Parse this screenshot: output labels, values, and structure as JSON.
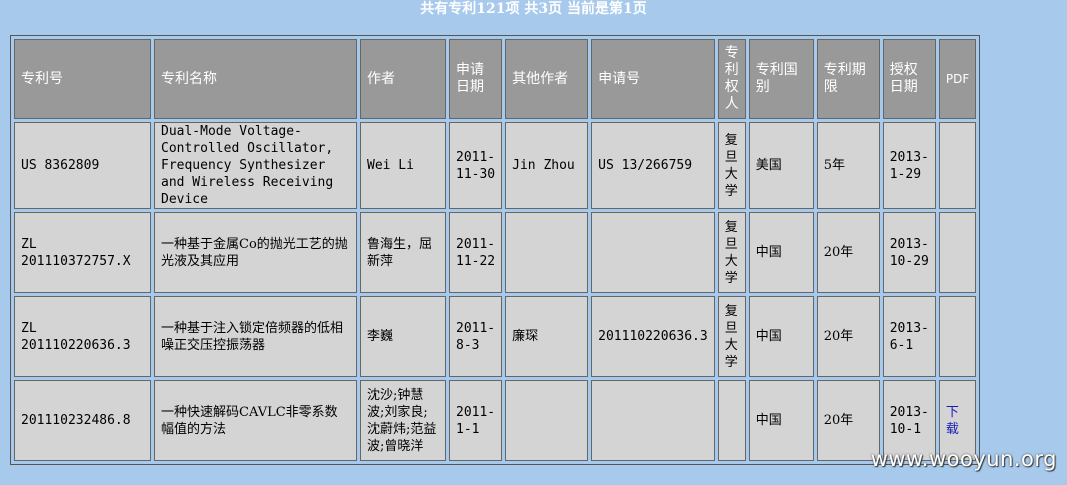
{
  "summary": "共有专利121项  共3页  当前是第1页",
  "headers": {
    "patent_no": "专利号",
    "patent_name": "专利名称",
    "author": "作者",
    "apply_date": "申请日期",
    "other_authors": "其他作者",
    "apply_no": "申请号",
    "holder": "专利权人",
    "country": "专利国别",
    "term": "专利期限",
    "grant_date": "授权日期",
    "pdf": "PDF"
  },
  "rows": [
    {
      "patent_no": "US 8362809",
      "patent_name": "Dual-Mode Voltage-Controlled Oscillator, Frequency Synthesizer and Wireless Receiving Device",
      "author": "Wei Li",
      "apply_date": "2011-11-30",
      "other_authors": "Jin Zhou",
      "apply_no": "US 13/266759",
      "holder": "复旦大学",
      "country": "美国",
      "term": "5年",
      "grant_date": "2013-1-29",
      "pdf": ""
    },
    {
      "patent_no": "ZL 201110372757.X",
      "patent_name": "一种基于金属Co的抛光工艺的抛光液及其应用",
      "author": "鲁海生，屈新萍",
      "apply_date": "2011-11-22",
      "other_authors": "",
      "apply_no": "",
      "holder": "复旦大学",
      "country": "中国",
      "term": "20年",
      "grant_date": "2013-10-29",
      "pdf": ""
    },
    {
      "patent_no": "ZL 201110220636.3",
      "patent_name": "一种基于注入锁定倍频器的低相噪正交压控振荡器",
      "author": "李巍",
      "apply_date": "2011-8-3",
      "other_authors": "廉琛",
      "apply_no": "201110220636.3",
      "holder": "复旦大学",
      "country": "中国",
      "term": "20年",
      "grant_date": "2013-6-1",
      "pdf": ""
    },
    {
      "patent_no": "201110232486.8",
      "patent_name": "一种快速解码CAVLC非零系数幅值的方法",
      "author": "沈沙;钟慧波;刘家良;沈蔚炜;范益波;曾晓洋",
      "apply_date": "2011-1-1",
      "other_authors": "",
      "apply_no": "",
      "holder": "",
      "country": "中国",
      "term": "20年",
      "grant_date": "2013-10-1",
      "pdf": "下载"
    }
  ],
  "watermark": "www.wooyun.org"
}
